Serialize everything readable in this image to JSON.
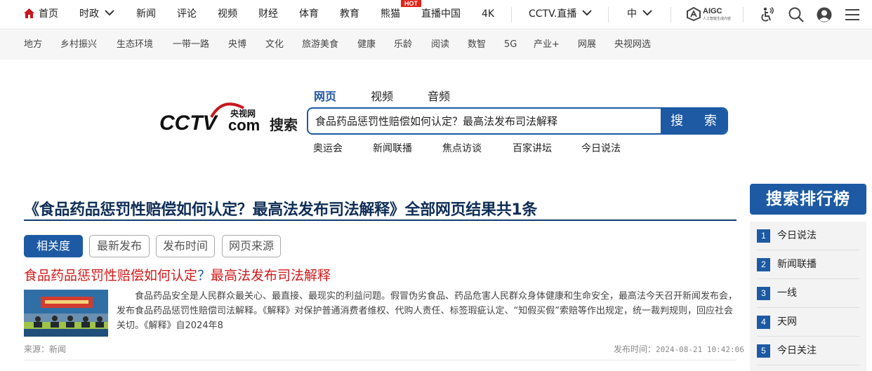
{
  "topnav": {
    "items": [
      "首页",
      "时政",
      "新闻",
      "评论",
      "视频",
      "财经",
      "体育",
      "教育",
      "熊猫",
      "直播中国",
      "4K",
      "CCTV.直播",
      "中"
    ],
    "hot_badge": "HOT",
    "aigc_title": "AIGC",
    "aigc_sub": "人工智能生成内容"
  },
  "subnav": {
    "items": [
      "地方",
      "乡村振兴",
      "生态环境",
      "一带一路",
      "央博",
      "文化",
      "旅游美食",
      "健康",
      "乐龄",
      "阅读",
      "数智",
      "5G",
      "产业+",
      "网展",
      "央视网选"
    ]
  },
  "logo": {
    "cn": "央视网",
    "wordmark": "CCTV",
    "dotcom": "com",
    "search_word": "搜索"
  },
  "search": {
    "tabs": [
      "网页",
      "视频",
      "音频"
    ],
    "query": "食品药品惩罚性赔偿如何认定？最高法发布司法解释",
    "button": "搜 索",
    "hot": [
      "奥运会",
      "新闻联播",
      "焦点访谈",
      "百家讲坛",
      "今日说法"
    ]
  },
  "results": {
    "summary_title": "《食品药品惩罚性赔偿如何认定？最高法发布司法解释》全部网页结果共1条",
    "sort": [
      "相关度",
      "最新发布",
      "发布时间",
      "网页来源"
    ],
    "items": [
      {
        "title_a": "食品药品惩罚性赔偿如何认定",
        "title_q": "？",
        "title_b": "最高法发布司法解释",
        "snippet": "食品药品安全是人民群众最关心、最直接、最现实的利益问题。假冒伪劣食品、药品危害人民群众身体健康和生命安全，最高法今天召开新闻发布会，发布食品药品惩罚性赔偿司法解释。《解释》对保护普通消费者维权、代购人责任、标签瑕疵认定、“知假买假”索赔等作出规定，统一裁判规则，回应社会关切。《解释》自2024年8",
        "source_label": "来源：",
        "source": "新闻",
        "time_label": "发布时间：",
        "time": "2024-08-21 10:42:06"
      }
    ]
  },
  "ranking": {
    "title": "搜索排行榜",
    "items": [
      {
        "num": "1",
        "label": "今日说法"
      },
      {
        "num": "2",
        "label": "新闻联播"
      },
      {
        "num": "3",
        "label": "一线"
      },
      {
        "num": "4",
        "label": "天网"
      },
      {
        "num": "5",
        "label": "今日关注"
      }
    ]
  },
  "colors": {
    "brand_blue": "#1d5aa3",
    "title_navy": "#0f2e57",
    "link_red": "#d11a1a",
    "hot_red": "#e2231a"
  }
}
